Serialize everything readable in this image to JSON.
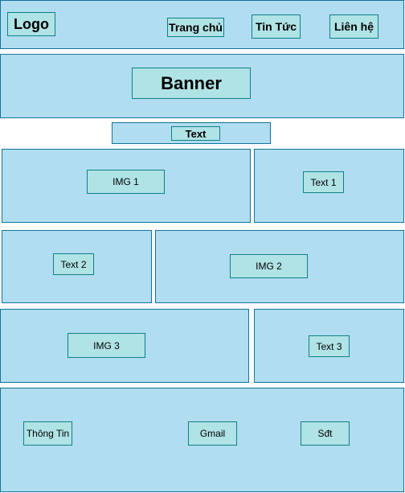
{
  "header": {
    "logo": "Logo",
    "nav": [
      "Trang chủ",
      "Tin Tức",
      "Liên hệ"
    ]
  },
  "banner": {
    "label": "Banner"
  },
  "text_bar": {
    "label": "Text"
  },
  "rows": [
    {
      "img": "IMG 1",
      "text": "Text 1"
    },
    {
      "text": "Text 2",
      "img": "IMG 2"
    },
    {
      "img": "IMG 3",
      "text": "Text 3"
    }
  ],
  "footer": {
    "items": [
      "Thông Tin",
      "Gmail",
      "Sđt"
    ]
  },
  "colors": {
    "section_fill": "#b1ddf0",
    "section_stroke": "#10739e",
    "label_fill": "#b0e3e6",
    "label_stroke": "#0e8088"
  }
}
